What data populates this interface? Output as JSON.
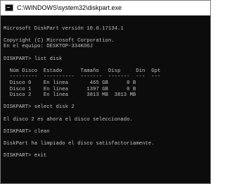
{
  "window": {
    "title": "C:\\WINDOWS\\system32\\diskpart.exe"
  },
  "console": {
    "lines": [
      "",
      "Microsoft DiskPart versión 10.0.17134.1",
      "",
      "Copyright (C) Microsoft Corporation.",
      "En el equipo: DESKTOP-334K06J",
      "",
      "DISKPART> list disk",
      "",
      "  Núm Disco  Estado      Tamaño   Disp     Din  Gpt",
      "  ---------  ----------  -------  -------  ---  ---",
      "  Disco 0    En línea       465 GB      0 B",
      "  Disco 1    En línea      1397 GB      0 B",
      "  Disco 2    En línea      3813 MB  3813 MB",
      "",
      "DISKPART> select disk 2",
      "",
      "El disco 2 es ahora el disco seleccionado.",
      "",
      "DISKPART> clean",
      "",
      "DiskPart ha limpiado el disco satisfactoriamente.",
      "",
      "DISKPART> exit",
      ""
    ]
  }
}
